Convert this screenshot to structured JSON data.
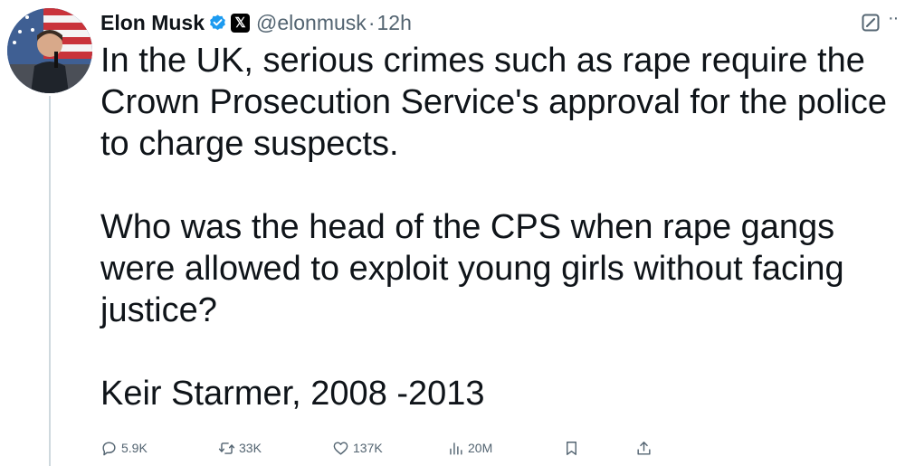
{
  "author": {
    "display_name": "Elon Musk",
    "handle": "@elonmusk",
    "separator": "·",
    "time": "12h",
    "verified_color": "#1d9bf0",
    "affiliate_badge": "𝕏"
  },
  "tweet": {
    "paragraphs": [
      "In the UK, serious crimes such as rape require the Crown Prosecution Service's approval for the police to charge suspects.",
      "Who was the head of the CPS when rape gangs were allowed to exploit young girls without facing justice?",
      "Keir Starmer, 2008 -2013"
    ]
  },
  "actions": {
    "reply_count": "5.9K",
    "repost_count": "33K",
    "like_count": "137K",
    "view_count": "20M"
  },
  "icons": {
    "reply": "reply-icon",
    "repost": "repost-icon",
    "like": "heart-icon",
    "views": "views-icon",
    "bookmark": "bookmark-icon",
    "share": "share-icon",
    "grok": "grok-icon",
    "more": "more-icon"
  },
  "colors": {
    "text": "#0f1419",
    "secondary": "#536471",
    "thread_line": "#cfd9de"
  }
}
